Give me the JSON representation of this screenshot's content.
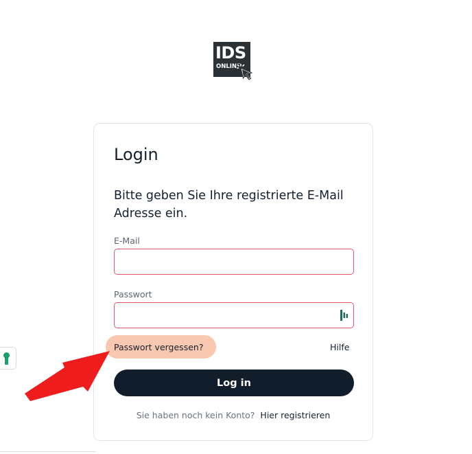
{
  "logo": {
    "text": "IDS",
    "subtext": "ONLINE",
    "icon": "cursor-click-icon",
    "background": "#2b3134"
  },
  "login": {
    "title": "Login",
    "subtitle": "Bitte geben Sie Ihre registrierte E-Mail Adresse ein.",
    "email_label": "E-Mail",
    "email_value": "",
    "password_label": "Passwort",
    "password_value": "",
    "password_manager_icon": "password-manager-icon",
    "forgot_label": "Passwort vergessen?",
    "help_label": "Hilfe",
    "submit_label": "Log in",
    "no_account_text": "Sie haben noch kein Konto?",
    "register_label": "Hier registrieren"
  },
  "colors": {
    "button": "#121d2b",
    "input_border": "#e2546a",
    "highlight": "#f9c8b0",
    "arrow": "#ee1c1c"
  },
  "overlay": {
    "arrow_icon": "red-arrow-annotation-icon",
    "side_tab_icon": "green-keyhole-icon"
  }
}
